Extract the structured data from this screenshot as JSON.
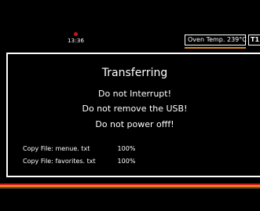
{
  "status": {
    "time": "13:36",
    "indicator_color": "#c81414"
  },
  "oven": {
    "temp_label": "Oven Temp.",
    "temp_value": "239°C",
    "timer_badge": "T1",
    "accent_color": "#e08a1c"
  },
  "dialog": {
    "title": "Transferring",
    "warnings": [
      "Do not Interrupt!",
      "Do not remove the USB!",
      "Do not power offf!"
    ],
    "copy_items": [
      {
        "label": "Copy File: menue. txt",
        "progress": "100%"
      },
      {
        "label": "Copy File: favorites. txt",
        "progress": "100%"
      }
    ]
  }
}
